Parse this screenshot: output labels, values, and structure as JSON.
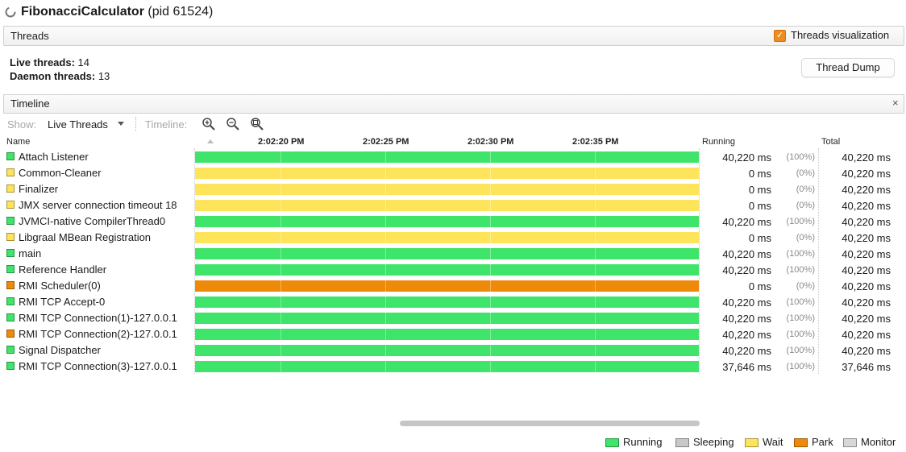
{
  "window": {
    "app_name": "FibonacciCalculator",
    "pid_label": "(pid 61524)"
  },
  "threads_tab": {
    "label": "Threads",
    "visualization_checkbox_label": "Threads visualization",
    "visualization_checked": true
  },
  "stats": {
    "live_label": "Live threads:",
    "live_value": "14",
    "daemon_label": "Daemon threads:",
    "daemon_value": "13"
  },
  "thread_dump_label": "Thread Dump",
  "timeline_tab": {
    "label": "Timeline",
    "close_glyph": "×"
  },
  "toolbar": {
    "show_label": "Show:",
    "show_value": "Live Threads",
    "timeline_label": "Timeline:",
    "icons": [
      "zoom-in-icon",
      "zoom-out-icon",
      "zoom-fit-icon"
    ]
  },
  "table": {
    "headers": {
      "name": "Name",
      "running": "Running",
      "total": "Total"
    },
    "time_ticks": [
      "2:02:20 PM",
      "2:02:25 PM",
      "2:02:30 PM",
      "2:02:35 PM"
    ],
    "rows": [
      {
        "name": "Attach Listener",
        "state": "running",
        "running": "40,220 ms",
        "pct": "(100%)",
        "total": "40,220 ms"
      },
      {
        "name": "Common-Cleaner",
        "state": "wait",
        "running": "0 ms",
        "pct": "(0%)",
        "total": "40,220 ms"
      },
      {
        "name": "Finalizer",
        "state": "wait",
        "running": "0 ms",
        "pct": "(0%)",
        "total": "40,220 ms"
      },
      {
        "name": "JMX server connection timeout 18",
        "state": "wait",
        "running": "0 ms",
        "pct": "(0%)",
        "total": "40,220 ms"
      },
      {
        "name": "JVMCI-native CompilerThread0",
        "state": "running",
        "running": "40,220 ms",
        "pct": "(100%)",
        "total": "40,220 ms"
      },
      {
        "name": "Libgraal MBean Registration",
        "state": "wait",
        "running": "0 ms",
        "pct": "(0%)",
        "total": "40,220 ms"
      },
      {
        "name": "main",
        "state": "running",
        "running": "40,220 ms",
        "pct": "(100%)",
        "total": "40,220 ms"
      },
      {
        "name": "Reference Handler",
        "state": "running",
        "running": "40,220 ms",
        "pct": "(100%)",
        "total": "40,220 ms"
      },
      {
        "name": "RMI Scheduler(0)",
        "state": "park",
        "running": "0 ms",
        "pct": "(0%)",
        "total": "40,220 ms"
      },
      {
        "name": "RMI TCP Accept-0",
        "state": "running",
        "running": "40,220 ms",
        "pct": "(100%)",
        "total": "40,220 ms"
      },
      {
        "name": "RMI TCP Connection(1)-127.0.0.1",
        "state": "running",
        "running": "40,220 ms",
        "pct": "(100%)",
        "total": "40,220 ms"
      },
      {
        "name": "RMI TCP Connection(2)-127.0.0.1",
        "state": "running",
        "swatch_state": "park",
        "running": "40,220 ms",
        "pct": "(100%)",
        "total": "40,220 ms"
      },
      {
        "name": "Signal Dispatcher",
        "state": "running",
        "running": "40,220 ms",
        "pct": "(100%)",
        "total": "40,220 ms"
      },
      {
        "name": "RMI TCP Connection(3)-127.0.0.1",
        "state": "running",
        "running": "37,646 ms",
        "pct": "(100%)",
        "total": "37,646 ms",
        "bar_start_fraction": 0.0
      }
    ]
  },
  "legend": [
    {
      "label": "Running",
      "state": "running"
    },
    {
      "label": "Sleeping",
      "state": "sleeping"
    },
    {
      "label": "Wait",
      "state": "wait"
    },
    {
      "label": "Park",
      "state": "park"
    },
    {
      "label": "Monitor",
      "state": "monitor"
    }
  ],
  "state_colors": {
    "running": "#3fe46a",
    "sleeping": "#c8c8c8",
    "wait": "#fde45a",
    "park": "#ee8a0a",
    "monitor": "#d8d8d8"
  }
}
